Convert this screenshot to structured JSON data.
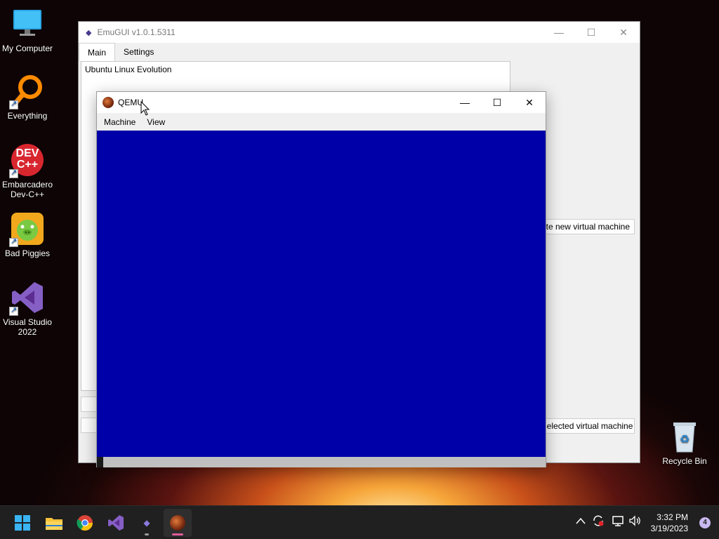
{
  "desktop": {
    "icons": [
      {
        "label": "My Computer"
      },
      {
        "label": "Everything"
      },
      {
        "label": "Embarcadero Dev-C++",
        "badge_line1": "DEV",
        "badge_line2": "C++"
      },
      {
        "label": "Bad Piggies"
      },
      {
        "label": "Visual Studio 2022"
      },
      {
        "label": "Recycle Bin"
      }
    ]
  },
  "emugui": {
    "title": "EmuGUI v1.0.1.5311",
    "tabs": [
      "Main",
      "Settings"
    ],
    "vm_list": [
      "Ubuntu Linux Evolution"
    ],
    "buttons": {
      "new_vm": "Create new virtual machine",
      "start_vm": "Start selected virtual machine"
    },
    "controls": {
      "minimize": "—",
      "maximize": "☐",
      "close": "✕"
    }
  },
  "qemu": {
    "title": "QEMU",
    "menu": [
      "Machine",
      "View"
    ],
    "screen_color": "#0000a8",
    "controls": {
      "minimize": "—",
      "maximize": "☐",
      "close": "✕"
    }
  },
  "taskbar": {
    "apps": [
      "start-icon",
      "file-explorer-icon",
      "chrome-icon",
      "visual-studio-icon",
      "emugui-icon",
      "qemu-icon"
    ],
    "tray": {
      "chevron": "^",
      "time": "3:32 PM",
      "date": "3/19/2023",
      "notifications": "4"
    }
  }
}
